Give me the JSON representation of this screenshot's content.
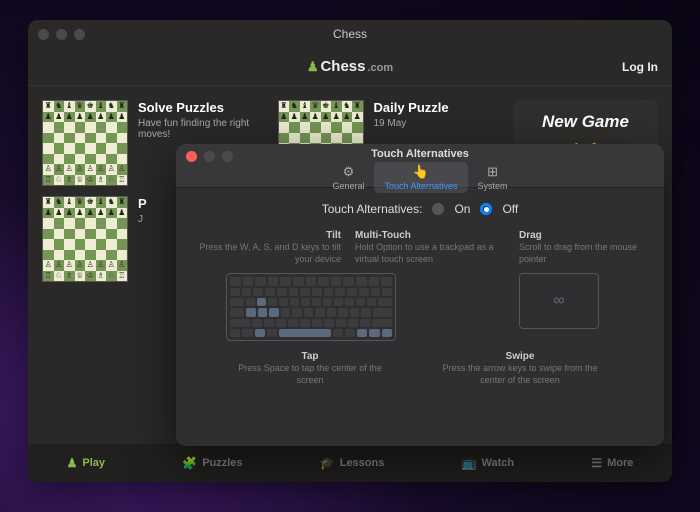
{
  "main": {
    "window_title": "Chess",
    "logo": {
      "brand": "Chess",
      "suffix": ".com"
    },
    "login": "Log In",
    "cards": {
      "solve": {
        "title": "Solve Puzzles",
        "subtitle": "Have fun finding the right moves!"
      },
      "daily": {
        "title": "Daily Puzzle",
        "subtitle": "19 May"
      },
      "third": {
        "title": "P",
        "subtitle": "J"
      }
    },
    "new_game": {
      "heading": "New Game"
    },
    "nav": {
      "play": "Play",
      "puzzles": "Puzzles",
      "lessons": "Lessons",
      "watch": "Watch",
      "more": "More"
    }
  },
  "settings": {
    "window_title": "Touch Alternatives",
    "tabs": {
      "general": "General",
      "touch": "Touch Alternatives",
      "system": "System"
    },
    "toggle": {
      "label": "Touch Alternatives:",
      "on": "On",
      "off": "Off"
    },
    "blocks": {
      "tilt": {
        "title": "Tilt",
        "desc": "Press the W, A, S, and D keys to tilt your device"
      },
      "multi": {
        "title": "Multi-Touch",
        "desc": "Hold Option to use a trackpad as a virtual touch screen"
      },
      "drag": {
        "title": "Drag",
        "desc": "Scroll to drag from the mouse pointer"
      },
      "tap": {
        "title": "Tap",
        "desc": "Press Space to tap the center of the screen"
      },
      "swipe": {
        "title": "Swipe",
        "desc": "Press the arrow keys to swipe from the center of the screen"
      }
    }
  }
}
